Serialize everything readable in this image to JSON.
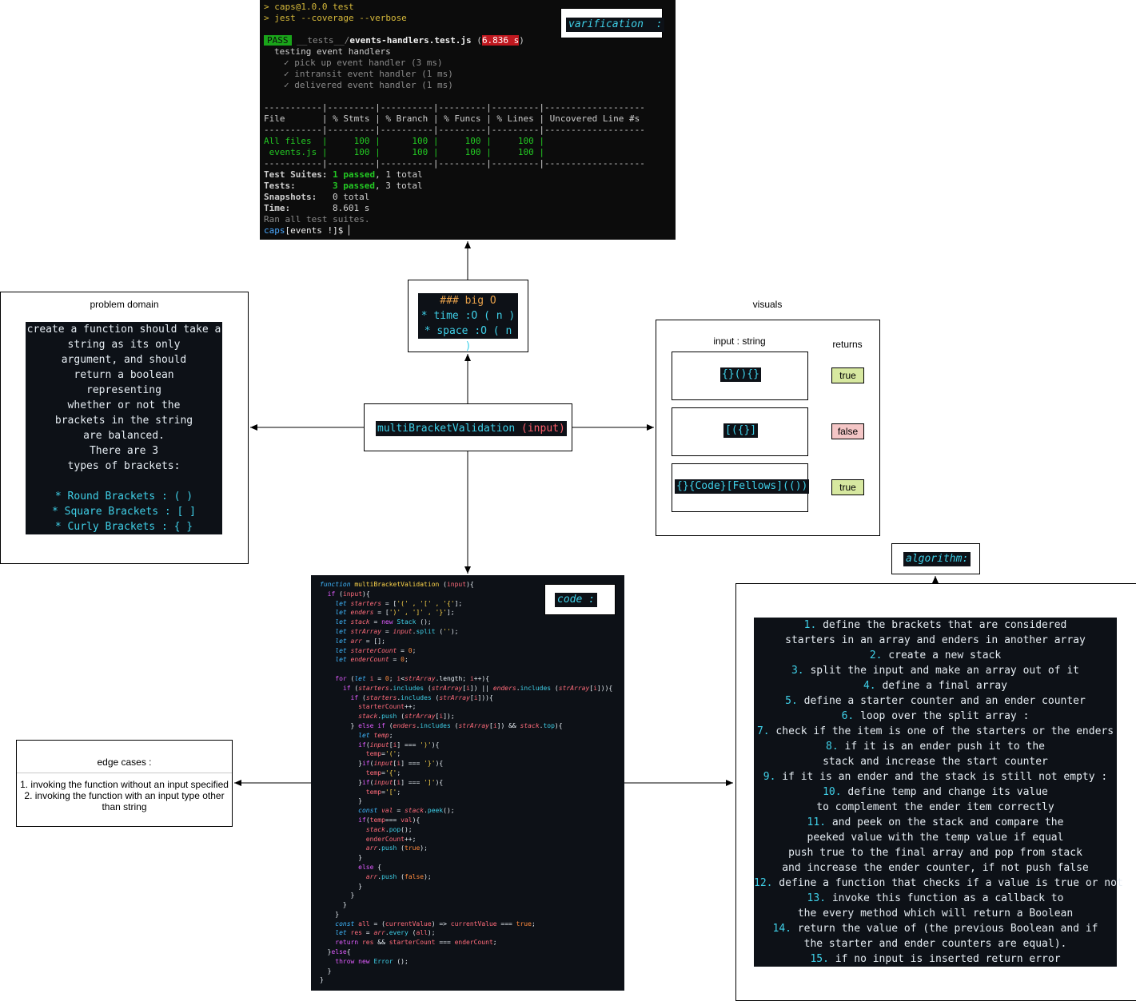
{
  "terminal": {
    "cmd1": "> caps@1.0.0 test",
    "cmd2": "> jest --coverage --verbose",
    "pass": "PASS",
    "test_dir": "__tests__/",
    "test_file": "events-handlers.test.js",
    "test_time": "6.836 s",
    "suite": "testing event handlers",
    "tests": [
      "✓ pick up event handler (3 ms)",
      "✓ intransit event handler (1 ms)",
      "✓ delivered event handler (1 ms)"
    ],
    "table_rule": "-----------|---------|----------|---------|---------|-------------------",
    "table_header": "File       | % Stmts | % Branch | % Funcs | % Lines | Uncovered Line #s",
    "row_all": "All files  |     100 |      100 |     100 |     100 |",
    "row_events": " events.js |     100 |      100 |     100 |     100 |",
    "suites_label": "Test Suites:",
    "suites_passed": "1 passed",
    "suites_total": ", 1 total",
    "tests_label": "Tests:",
    "tests_passed": "3 passed",
    "tests_total": ", 3 total",
    "snapshots_label": "Snapshots:",
    "snapshots_val": "0 total",
    "time_label": "Time:",
    "time_val": "8.601 s",
    "ran": "Ran all test suites.",
    "prompt_a": "caps",
    "prompt_b": "[events !]$"
  },
  "labels": {
    "verification": "varification  :",
    "code": "code :",
    "algorithm": "algorithm:"
  },
  "bigo": {
    "title": "### big O",
    "time": "* time  :O ( n )",
    "space": "* space :O ( n )"
  },
  "func": {
    "name": "multiBracketValidation",
    "param": "(input)"
  },
  "problem": {
    "title": "problem domain",
    "lines": [
      "create a function should take a",
      "string as its only",
      "argument, and should",
      "return a boolean",
      "representing",
      "whether or not the",
      "brackets in the string",
      "are balanced.",
      "There are 3",
      "types of brackets:",
      ""
    ],
    "types": [
      "* Round Brackets : ( )",
      "* Square Brackets : [ ]",
      "* Curly Brackets : { }"
    ]
  },
  "visuals": {
    "title": "visuals",
    "input_title": "input : string",
    "returns_title": "returns",
    "examples": [
      {
        "input": "{}(){}",
        "result": "true"
      },
      {
        "input": "[({}]",
        "result": "false"
      },
      {
        "input": "{}{Code}[Fellows](())",
        "result": "true"
      }
    ]
  },
  "edge": {
    "title": "edge cases :",
    "items": [
      "1. invoking the function without an input specified",
      "2. invoking the function with an input type other",
      "than string"
    ]
  },
  "algorithm": {
    "lines": [
      {
        "n": "1.",
        "t": " define the brackets that are considered"
      },
      {
        "n": "",
        "t": "starters in an array and enders in another array"
      },
      {
        "n": "2.",
        "t": " create a new stack"
      },
      {
        "n": "3.",
        "t": " split the input and make an array out of it"
      },
      {
        "n": "4.",
        "t": " define a final array"
      },
      {
        "n": "5.",
        "t": " define a starter counter and an ender counter"
      },
      {
        "n": "6.",
        "t": " loop over the split array :"
      },
      {
        "n": "7.",
        "t": " check if the item is one of the starters or the enders"
      },
      {
        "n": "8.",
        "t": " if it is an ender push it to the"
      },
      {
        "n": "",
        "t": "stack and increase the start counter"
      },
      {
        "n": "9.",
        "t": " if it is an ender and the stack is still not empty :"
      },
      {
        "n": "10.",
        "t": " define temp and change its value"
      },
      {
        "n": "",
        "t": "to complement the ender item correctly"
      },
      {
        "n": "11.",
        "t": " and peek on the stack and compare the"
      },
      {
        "n": "",
        "t": "peeked value with the temp value if equal"
      },
      {
        "n": "",
        "t": "push true to the final array and pop from stack"
      },
      {
        "n": "",
        "t": "and increase the ender counter, if not push false"
      },
      {
        "n": "12.",
        "t": " define a function that checks if a value is true or not"
      },
      {
        "n": "13.",
        "t": " invoke this function as a callback to"
      },
      {
        "n": "",
        "t": "the every method which will return a Boolean"
      },
      {
        "n": "14.",
        "t": " return the value of (the previous Boolean and if"
      },
      {
        "n": "",
        "t": "the starter and ender counters are equal)."
      },
      {
        "n": "15.",
        "t": " if no input is inserted return error"
      }
    ]
  },
  "code": {
    "lines": [
      [
        [
          "kw",
          "function "
        ],
        [
          "fn",
          "multiBracketValidation "
        ],
        [
          "",
          "("
        ],
        [
          "vr",
          "input"
        ],
        [
          "",
          "){"
        ]
      ],
      [
        [
          "",
          "  "
        ],
        [
          "pl",
          "if "
        ],
        [
          "",
          "("
        ],
        [
          "vr",
          "input"
        ],
        [
          "",
          "){"
        ]
      ],
      [
        [
          "",
          "    "
        ],
        [
          "kw",
          "let "
        ],
        [
          "vi",
          "starters"
        ],
        [
          "",
          " = ["
        ],
        [
          "st",
          "'(' , '[' , '{'"
        ],
        [
          "",
          "];"
        ]
      ],
      [
        [
          "",
          "    "
        ],
        [
          "kw",
          "let "
        ],
        [
          "vi",
          "enders"
        ],
        [
          "",
          " = ["
        ],
        [
          "st",
          "')' , ']' , '}'"
        ],
        [
          "",
          "];"
        ]
      ],
      [
        [
          "",
          "    "
        ],
        [
          "kw",
          "let "
        ],
        [
          "vi",
          "stack"
        ],
        [
          "",
          " = "
        ],
        [
          "pl",
          "new "
        ],
        [
          "pr",
          "Stack "
        ],
        [
          "",
          "();"
        ]
      ],
      [
        [
          "",
          "    "
        ],
        [
          "kw",
          "let "
        ],
        [
          "vi",
          "strArray"
        ],
        [
          "",
          " = "
        ],
        [
          "vi",
          "input"
        ],
        [
          "",
          "."
        ],
        [
          "pr",
          "split "
        ],
        [
          "",
          "("
        ],
        [
          "st",
          "''"
        ],
        [
          "",
          ");"
        ]
      ],
      [
        [
          "",
          "    "
        ],
        [
          "kw",
          "let "
        ],
        [
          "vi",
          "arr"
        ],
        [
          "",
          " = [];"
        ]
      ],
      [
        [
          "",
          "    "
        ],
        [
          "kw",
          "let "
        ],
        [
          "vi",
          "starterCount"
        ],
        [
          "",
          " = "
        ],
        [
          "nm",
          "0"
        ],
        [
          "",
          ";"
        ]
      ],
      [
        [
          "",
          "    "
        ],
        [
          "kw",
          "let "
        ],
        [
          "vi",
          "enderCount"
        ],
        [
          "",
          " = "
        ],
        [
          "nm",
          "0"
        ],
        [
          "",
          ";"
        ]
      ],
      [
        [
          "",
          ""
        ]
      ],
      [
        [
          "",
          "    "
        ],
        [
          "pl",
          "for "
        ],
        [
          "",
          "("
        ],
        [
          "kw",
          "let "
        ],
        [
          "vr",
          "i"
        ],
        [
          "",
          " = "
        ],
        [
          "nm",
          "0"
        ],
        [
          "",
          "; "
        ],
        [
          "vr",
          "i"
        ],
        [
          "",
          "<"
        ],
        [
          "vi",
          "strArray"
        ],
        [
          "",
          ".length; "
        ],
        [
          "vr",
          "i"
        ],
        [
          "",
          "++){"
        ]
      ],
      [
        [
          "",
          "      "
        ],
        [
          "pl",
          "if "
        ],
        [
          "",
          "("
        ],
        [
          "vi",
          "starters"
        ],
        [
          "",
          "."
        ],
        [
          "pr",
          "includes "
        ],
        [
          "",
          "("
        ],
        [
          "vi",
          "strArray"
        ],
        [
          "",
          "["
        ],
        [
          "vr",
          "i"
        ],
        [
          "",
          "]) || "
        ],
        [
          "vi",
          "enders"
        ],
        [
          "",
          "."
        ],
        [
          "pr",
          "includes "
        ],
        [
          "",
          "("
        ],
        [
          "vi",
          "strArray"
        ],
        [
          "",
          "["
        ],
        [
          "vr",
          "i"
        ],
        [
          "",
          "])){"
        ]
      ],
      [
        [
          "",
          "        "
        ],
        [
          "pl",
          "if "
        ],
        [
          "",
          "("
        ],
        [
          "vi",
          "starters"
        ],
        [
          "",
          "."
        ],
        [
          "pr",
          "includes "
        ],
        [
          "",
          "("
        ],
        [
          "vi",
          "strArray"
        ],
        [
          "",
          "["
        ],
        [
          "vr",
          "i"
        ],
        [
          "",
          "])){"
        ]
      ],
      [
        [
          "",
          "          "
        ],
        [
          "vr",
          "starterCount"
        ],
        [
          "",
          "++;"
        ]
      ],
      [
        [
          "",
          "          "
        ],
        [
          "vi",
          "stack"
        ],
        [
          "",
          "."
        ],
        [
          "pr",
          "push "
        ],
        [
          "",
          "("
        ],
        [
          "vi",
          "strArray"
        ],
        [
          "",
          "["
        ],
        [
          "vr",
          "i"
        ],
        [
          "",
          "]);"
        ]
      ],
      [
        [
          "",
          "        } "
        ],
        [
          "pl",
          "else if "
        ],
        [
          "",
          "("
        ],
        [
          "vi",
          "enders"
        ],
        [
          "",
          "."
        ],
        [
          "pr",
          "includes "
        ],
        [
          "",
          "("
        ],
        [
          "vi",
          "strArray"
        ],
        [
          "",
          "["
        ],
        [
          "vr",
          "i"
        ],
        [
          "",
          "]) && "
        ],
        [
          "vi",
          "stack"
        ],
        [
          "",
          "."
        ],
        [
          "pr",
          "top"
        ],
        [
          "",
          ""
        ],
        [
          "",
          "){"
        ]
      ],
      [
        [
          "",
          "          "
        ],
        [
          "kw",
          "let "
        ],
        [
          "vi",
          "temp"
        ],
        [
          "",
          ";"
        ]
      ],
      [
        [
          "",
          "          "
        ],
        [
          "pl",
          "if"
        ],
        [
          "",
          "("
        ],
        [
          "vi",
          "input"
        ],
        [
          "",
          "["
        ],
        [
          "vr",
          "i"
        ],
        [
          "",
          "] === "
        ],
        [
          "st",
          "')'"
        ],
        [
          "",
          "){"
        ]
      ],
      [
        [
          "",
          "            "
        ],
        [
          "vr",
          "temp"
        ],
        [
          "",
          "="
        ],
        [
          "st",
          "'('"
        ],
        [
          "",
          ";"
        ]
      ],
      [
        [
          "",
          "          }"
        ],
        [
          "pl",
          "if"
        ],
        [
          "",
          "("
        ],
        [
          "vi",
          "input"
        ],
        [
          "",
          "["
        ],
        [
          "vr",
          "i"
        ],
        [
          "",
          "] === "
        ],
        [
          "st",
          "'}'"
        ],
        [
          "",
          "){"
        ]
      ],
      [
        [
          "",
          "            "
        ],
        [
          "vr",
          "temp"
        ],
        [
          "",
          "="
        ],
        [
          "st",
          "'{'"
        ],
        [
          "",
          ";"
        ]
      ],
      [
        [
          "",
          "          }"
        ],
        [
          "pl",
          "if"
        ],
        [
          "",
          "("
        ],
        [
          "vi",
          "input"
        ],
        [
          "",
          "["
        ],
        [
          "vr",
          "i"
        ],
        [
          "",
          "] === "
        ],
        [
          "st",
          "']'"
        ],
        [
          "",
          "){"
        ]
      ],
      [
        [
          "",
          "            "
        ],
        [
          "vr",
          "temp"
        ],
        [
          "",
          "="
        ],
        [
          "st",
          "'['"
        ],
        [
          "",
          ";"
        ]
      ],
      [
        [
          "",
          "          }"
        ]
      ],
      [
        [
          "",
          "          "
        ],
        [
          "kw",
          "const "
        ],
        [
          "vi",
          "val"
        ],
        [
          "",
          " = "
        ],
        [
          "vi",
          "stack"
        ],
        [
          "",
          "."
        ],
        [
          "pr",
          "peek"
        ],
        [
          "",
          "();"
        ]
      ],
      [
        [
          "",
          "          "
        ],
        [
          "pl",
          "if"
        ],
        [
          "",
          "("
        ],
        [
          "vr",
          "temp"
        ],
        [
          "",
          "=== "
        ],
        [
          "vr",
          "val"
        ],
        [
          "",
          "){"
        ]
      ],
      [
        [
          "",
          "            "
        ],
        [
          "vi",
          "stack"
        ],
        [
          "",
          "."
        ],
        [
          "pr",
          "pop"
        ],
        [
          "",
          "();"
        ]
      ],
      [
        [
          "",
          "            "
        ],
        [
          "vr",
          "enderCount"
        ],
        [
          "",
          "++;"
        ]
      ],
      [
        [
          "",
          "            "
        ],
        [
          "vi",
          "arr"
        ],
        [
          "",
          "."
        ],
        [
          "pr",
          "push "
        ],
        [
          "",
          "("
        ],
        [
          "nm",
          "true"
        ],
        [
          "",
          ");"
        ]
      ],
      [
        [
          "",
          "          }"
        ]
      ],
      [
        [
          "",
          "          "
        ],
        [
          "pl",
          "else "
        ],
        [
          "",
          "{"
        ]
      ],
      [
        [
          "",
          "            "
        ],
        [
          "vi",
          "arr"
        ],
        [
          "",
          "."
        ],
        [
          "pr",
          "push "
        ],
        [
          "",
          "("
        ],
        [
          "nm",
          "false"
        ],
        [
          "",
          ");"
        ]
      ],
      [
        [
          "",
          "          }"
        ]
      ],
      [
        [
          "",
          "        }"
        ]
      ],
      [
        [
          "",
          "      }"
        ]
      ],
      [
        [
          "",
          "    }"
        ]
      ],
      [
        [
          "",
          "    "
        ],
        [
          "kw",
          "const "
        ],
        [
          "vr",
          "all"
        ],
        [
          "",
          " = ("
        ],
        [
          "vr",
          "currentValue"
        ],
        [
          "",
          ") => "
        ],
        [
          "vr",
          "currentValue"
        ],
        [
          "",
          " === "
        ],
        [
          "nm",
          "true"
        ],
        [
          "",
          ";"
        ]
      ],
      [
        [
          "",
          "    "
        ],
        [
          "kw",
          "let "
        ],
        [
          "vr",
          "res"
        ],
        [
          "",
          " = "
        ],
        [
          "vi",
          "arr"
        ],
        [
          "",
          "."
        ],
        [
          "pr",
          "every "
        ],
        [
          "",
          "("
        ],
        [
          "vr",
          "all"
        ],
        [
          "",
          ");"
        ]
      ],
      [
        [
          "",
          "    "
        ],
        [
          "pl",
          "return "
        ],
        [
          "vr",
          "res"
        ],
        [
          "",
          " && "
        ],
        [
          "vr",
          "starterCount"
        ],
        [
          "",
          " === "
        ],
        [
          "vr",
          "enderCount"
        ],
        [
          "",
          ";"
        ]
      ],
      [
        [
          "",
          "  }"
        ],
        [
          "pl",
          "else"
        ],
        [
          "",
          "{"
        ]
      ],
      [
        [
          "",
          "    "
        ],
        [
          "pl",
          "throw "
        ],
        [
          "pl",
          "new "
        ],
        [
          "pr",
          "Error "
        ],
        [
          "",
          "();"
        ]
      ],
      [
        [
          "",
          "  }"
        ]
      ],
      [
        [
          "",
          "}"
        ]
      ]
    ]
  }
}
